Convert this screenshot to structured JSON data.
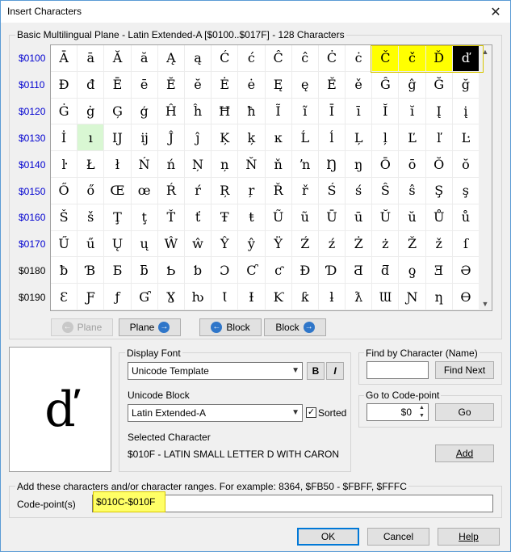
{
  "window": {
    "title": "Insert Characters",
    "close_glyph": "✕"
  },
  "block_group": {
    "label": "Basic Multilingual Plane - Latin Extended-A [$0100..$017F] - 128 Characters"
  },
  "rows": [
    {
      "code": "$0100",
      "chars": [
        "Ā",
        "ā",
        "Ă",
        "ă",
        "Ą",
        "ą",
        "Ć",
        "ć",
        "Ĉ",
        "ĉ",
        "Ċ",
        "ċ",
        "Č",
        "č",
        "Ď",
        "ď"
      ]
    },
    {
      "code": "$0110",
      "chars": [
        "Đ",
        "đ",
        "Ē",
        "ē",
        "Ĕ",
        "ĕ",
        "Ė",
        "ė",
        "Ę",
        "ę",
        "Ě",
        "ě",
        "Ĝ",
        "ĝ",
        "Ğ",
        "ğ"
      ]
    },
    {
      "code": "$0120",
      "chars": [
        "Ġ",
        "ġ",
        "Ģ",
        "ģ",
        "Ĥ",
        "ĥ",
        "Ħ",
        "ħ",
        "Ĩ",
        "ĩ",
        "Ī",
        "ī",
        "Ĭ",
        "ĭ",
        "Į",
        "į"
      ]
    },
    {
      "code": "$0130",
      "chars": [
        "İ",
        "ı",
        "Ĳ",
        "ĳ",
        "Ĵ",
        "ĵ",
        "Ķ",
        "ķ",
        "ĸ",
        "Ĺ",
        "ĺ",
        "Ļ",
        "ļ",
        "Ľ",
        "ľ",
        "Ŀ"
      ]
    },
    {
      "code": "$0140",
      "chars": [
        "ŀ",
        "Ł",
        "ł",
        "Ń",
        "ń",
        "Ņ",
        "ņ",
        "Ň",
        "ň",
        "ŉ",
        "Ŋ",
        "ŋ",
        "Ō",
        "ō",
        "Ŏ",
        "ŏ"
      ]
    },
    {
      "code": "$0150",
      "chars": [
        "Ő",
        "ő",
        "Œ",
        "œ",
        "Ŕ",
        "ŕ",
        "Ŗ",
        "ŗ",
        "Ř",
        "ř",
        "Ś",
        "ś",
        "Ŝ",
        "ŝ",
        "Ş",
        "ş"
      ]
    },
    {
      "code": "$0160",
      "chars": [
        "Š",
        "š",
        "Ţ",
        "ţ",
        "Ť",
        "ť",
        "Ŧ",
        "ŧ",
        "Ũ",
        "ũ",
        "Ū",
        "ū",
        "Ŭ",
        "ŭ",
        "Ů",
        "ů"
      ]
    },
    {
      "code": "$0170",
      "chars": [
        "Ű",
        "ű",
        "Ų",
        "ų",
        "Ŵ",
        "ŵ",
        "Ŷ",
        "ŷ",
        "Ÿ",
        "Ź",
        "ź",
        "Ż",
        "ż",
        "Ž",
        "ž",
        "ſ"
      ]
    },
    {
      "code": "$0180",
      "chars": [
        "ƀ",
        "Ɓ",
        "Ƃ",
        "ƃ",
        "Ƅ",
        "ƅ",
        "Ɔ",
        "Ƈ",
        "ƈ",
        "Ɖ",
        "Ɗ",
        "Ƌ",
        "ƌ",
        "ƍ",
        "Ǝ",
        "Ə"
      ]
    },
    {
      "code": "$0190",
      "chars": [
        "Ɛ",
        "Ƒ",
        "ƒ",
        "Ɠ",
        "Ɣ",
        "ƕ",
        "Ɩ",
        "Ɨ",
        "Ƙ",
        "ƙ",
        "ƚ",
        "ƛ",
        "Ɯ",
        "Ɲ",
        "ƞ",
        "Ɵ"
      ]
    }
  ],
  "nav": {
    "plane_prev": "Plane",
    "plane_next": "Plane",
    "block_prev": "Block",
    "block_next": "Block"
  },
  "preview": {
    "glyph": "ď"
  },
  "display_font": {
    "label": "Display Font",
    "value": "Unicode Template",
    "bold": "B",
    "italic": "I"
  },
  "unicode_block": {
    "label": "Unicode Block",
    "value": "Latin Extended-A",
    "sorted_label": "Sorted",
    "sorted_checked": "✓"
  },
  "find_by_name": {
    "label": "Find by Character (Name)",
    "value": "",
    "button": "Find Next"
  },
  "goto": {
    "label": "Go to Code-point",
    "value": "$0",
    "button": "Go"
  },
  "selected": {
    "label": "Selected Character",
    "value": "$010F - LATIN SMALL LETTER D WITH CARON",
    "add_button": "Add"
  },
  "add_group": {
    "hint": "Add these characters and/or character ranges. For example: 8364, $FB50 - $FBFF, $FFFC",
    "field_label": "Code-point(s)",
    "field_value": "$010C-$010F"
  },
  "footer": {
    "ok": "OK",
    "cancel": "Cancel",
    "help": "Help"
  },
  "colors": {
    "highlight": "#ffff00",
    "selected": "#000000",
    "current": "#d9f7d3",
    "row_link": "#0000d0"
  }
}
